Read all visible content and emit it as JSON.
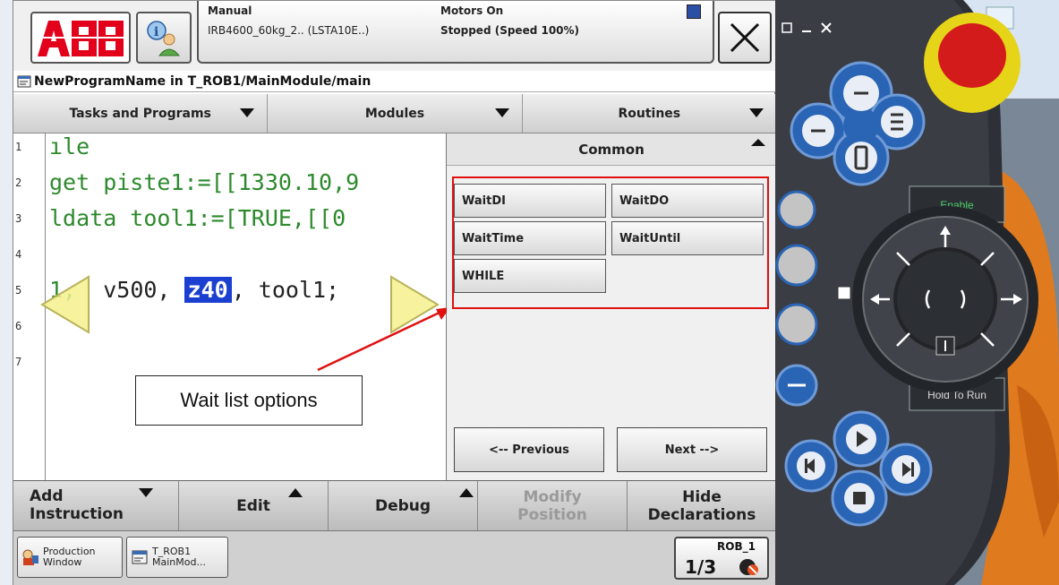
{
  "header": {
    "mode": "Manual",
    "robot": "IRB4600_60kg_2.. (LSTA10E..)",
    "motors": "Motors On",
    "state": "Stopped (Speed 100%)"
  },
  "title": "NewProgramName in T_ROB1/MainModule/main",
  "nav": {
    "tasks": "Tasks and Programs",
    "modules": "Modules",
    "routines": "Routines"
  },
  "editor": {
    "line_numbers": [
      "1",
      "2",
      "3",
      "4",
      "5",
      "6",
      "7"
    ],
    "lines": [
      "ıle",
      "get piste1:=[[1330.10,9",
      "ldata tool1:=[TRUE,[[0",
      "",
      "1,",
      "",
      ""
    ],
    "line5_speed": "v500,",
    "line5_zone": "z40",
    "line5_tool": ", tool1;",
    "callout": "Wait list options"
  },
  "panel": {
    "title": "Common",
    "buttons": [
      "WaitDI",
      "WaitDO",
      "WaitTime",
      "WaitUntil",
      "WHILE"
    ],
    "previous": "<-- Previous",
    "next": "Next -->"
  },
  "commands": {
    "add_line1": "Add",
    "add_line2": "Instruction",
    "edit": "Edit",
    "debug": "Debug",
    "modify_line1": "Modify",
    "modify_line2": "Position",
    "hide_line1": "Hide",
    "hide_line2": "Declarations"
  },
  "taskbar": {
    "production": [
      "Production",
      "Window"
    ],
    "trob": [
      "T_ROB1",
      "MainMod..."
    ],
    "rob": "ROB_1",
    "rob_sub": "1/3"
  },
  "hardware": {
    "enable": "Enable",
    "hold_to_run": "Hold To Run"
  },
  "colors": {
    "abb_red": "#e2001a",
    "highlight": "#1b3fd0",
    "code_green": "#2d8a2d",
    "callout_red": "#e01010",
    "pendant_blue": "#2a64b4"
  }
}
